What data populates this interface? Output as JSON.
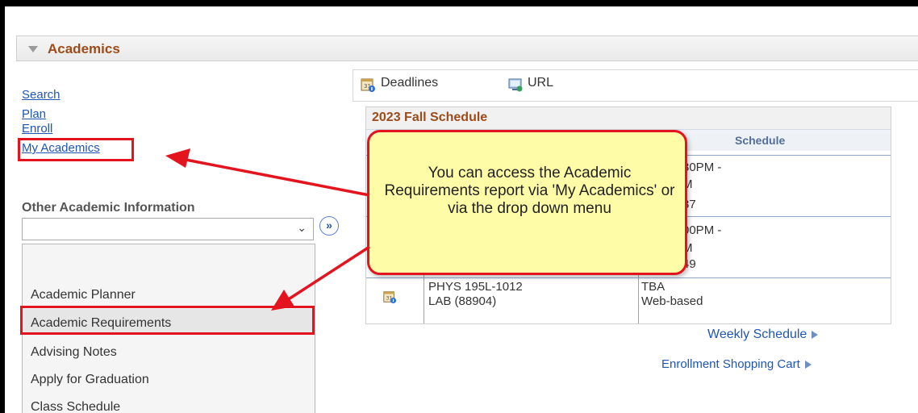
{
  "section": {
    "title": "Academics"
  },
  "nav": {
    "search": "Search",
    "plan": "Plan",
    "enroll": "Enroll",
    "my_academics": "My Academics"
  },
  "other": {
    "label": "Other Academic Information",
    "selected": "",
    "go_icon": "double-chevron-right-icon",
    "options": [
      "Academic Planner",
      "Academic Requirements",
      "Advising Notes",
      "Apply for Graduation",
      "Class Schedule"
    ]
  },
  "toolbar": {
    "deadlines": "Deadlines",
    "url": "URL"
  },
  "schedule": {
    "title": "2023 Fall Schedule",
    "column": "Schedule",
    "rows": [
      {
        "sched": [
          "30PM -",
          "M",
          "37"
        ]
      },
      {
        "sched": [
          "00PM -",
          "M",
          "49"
        ]
      },
      {
        "class": "PHYS 195L-1012",
        "type": "LAB (88904)",
        "sched": [
          "TBA",
          "Web-based"
        ]
      }
    ]
  },
  "links": {
    "weekly": "Weekly Schedule",
    "cart": "Enrollment Shopping Cart"
  },
  "callout": {
    "text": "You can access the Academic Requirements report via 'My Academics' or via the drop down menu"
  },
  "colors": {
    "accent_red": "#e4141f",
    "link_blue": "#1f56b5",
    "header_brown": "#9c4c1a",
    "callout_yellow": "#fffca8"
  }
}
